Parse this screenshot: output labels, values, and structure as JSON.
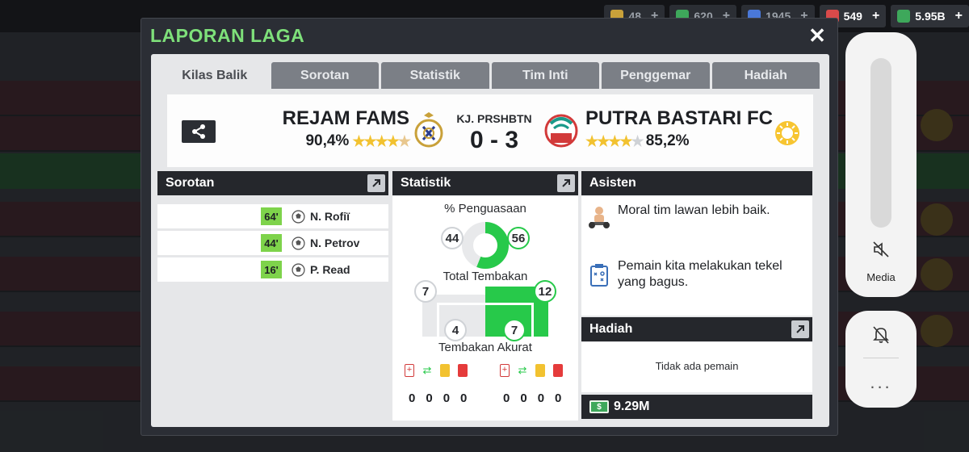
{
  "topbar": {
    "resources": [
      {
        "value": "48",
        "icon": "token-icon",
        "color": "#c9a13a"
      },
      {
        "value": "620",
        "icon": "cash-icon",
        "color": "#3ea85b"
      },
      {
        "value": "1945",
        "icon": "boost-icon",
        "color": "#4a78d8"
      },
      {
        "value": "549",
        "icon": "medical-icon",
        "color": "#d84a4a"
      },
      {
        "value": "5.95B",
        "icon": "money-icon",
        "color": "#3ea85b"
      }
    ]
  },
  "modal": {
    "title": "LAPORAN LAGA",
    "close_icon": "close-icon",
    "tabs": [
      "Kilas Balik",
      "Sorotan",
      "Statistik",
      "Tim Inti",
      "Penggemar",
      "Hadiah"
    ],
    "active_tab": "Kilas Balik"
  },
  "match": {
    "home": {
      "name": "REJAM FAMS",
      "rating": "90,4%",
      "stars": 4.5
    },
    "away": {
      "name": "PUTRA BASTARI FC",
      "rating": "85,2%",
      "stars": 4
    },
    "stadium": "KJ. PRSHBTN",
    "score": "0 - 3",
    "weather_icon": "sun-icon"
  },
  "highlights": {
    "title": "Sorotan",
    "items": [
      {
        "minute": "64'",
        "player": "N. Rofiï"
      },
      {
        "minute": "44'",
        "player": "N. Petrov"
      },
      {
        "minute": "16'",
        "player": "P. Read"
      }
    ]
  },
  "stats": {
    "title": "Statistik",
    "possession_label": "% Penguasaan",
    "possession_home": "44",
    "possession_away": "56",
    "possession_fraction_away": 0.56,
    "shots_label": "Total Tembakan",
    "shots_home": "7",
    "shots_away": "12",
    "on_target_label": "Tembakan Akurat",
    "on_target_home": "4",
    "on_target_away": "7",
    "home_counts": [
      "0",
      "0",
      "0",
      "0"
    ],
    "away_counts": [
      "0",
      "0",
      "0",
      "0"
    ],
    "count_icons": [
      "injury-icon",
      "substitution-icon",
      "yellow-card-icon",
      "red-card-icon"
    ]
  },
  "assistant": {
    "title": "Asisten",
    "messages": [
      {
        "icon": "fitness-icon",
        "text": "Moral tim lawan lebih baik."
      },
      {
        "icon": "clipboard-icon",
        "text": "Pemain kita melakukan tekel yang bagus."
      }
    ]
  },
  "reward": {
    "title": "Hadiah",
    "empty_text": "Tidak ada pemain",
    "amount": "9.29M"
  },
  "system": {
    "media_label": "Media",
    "more_label": "..."
  }
}
